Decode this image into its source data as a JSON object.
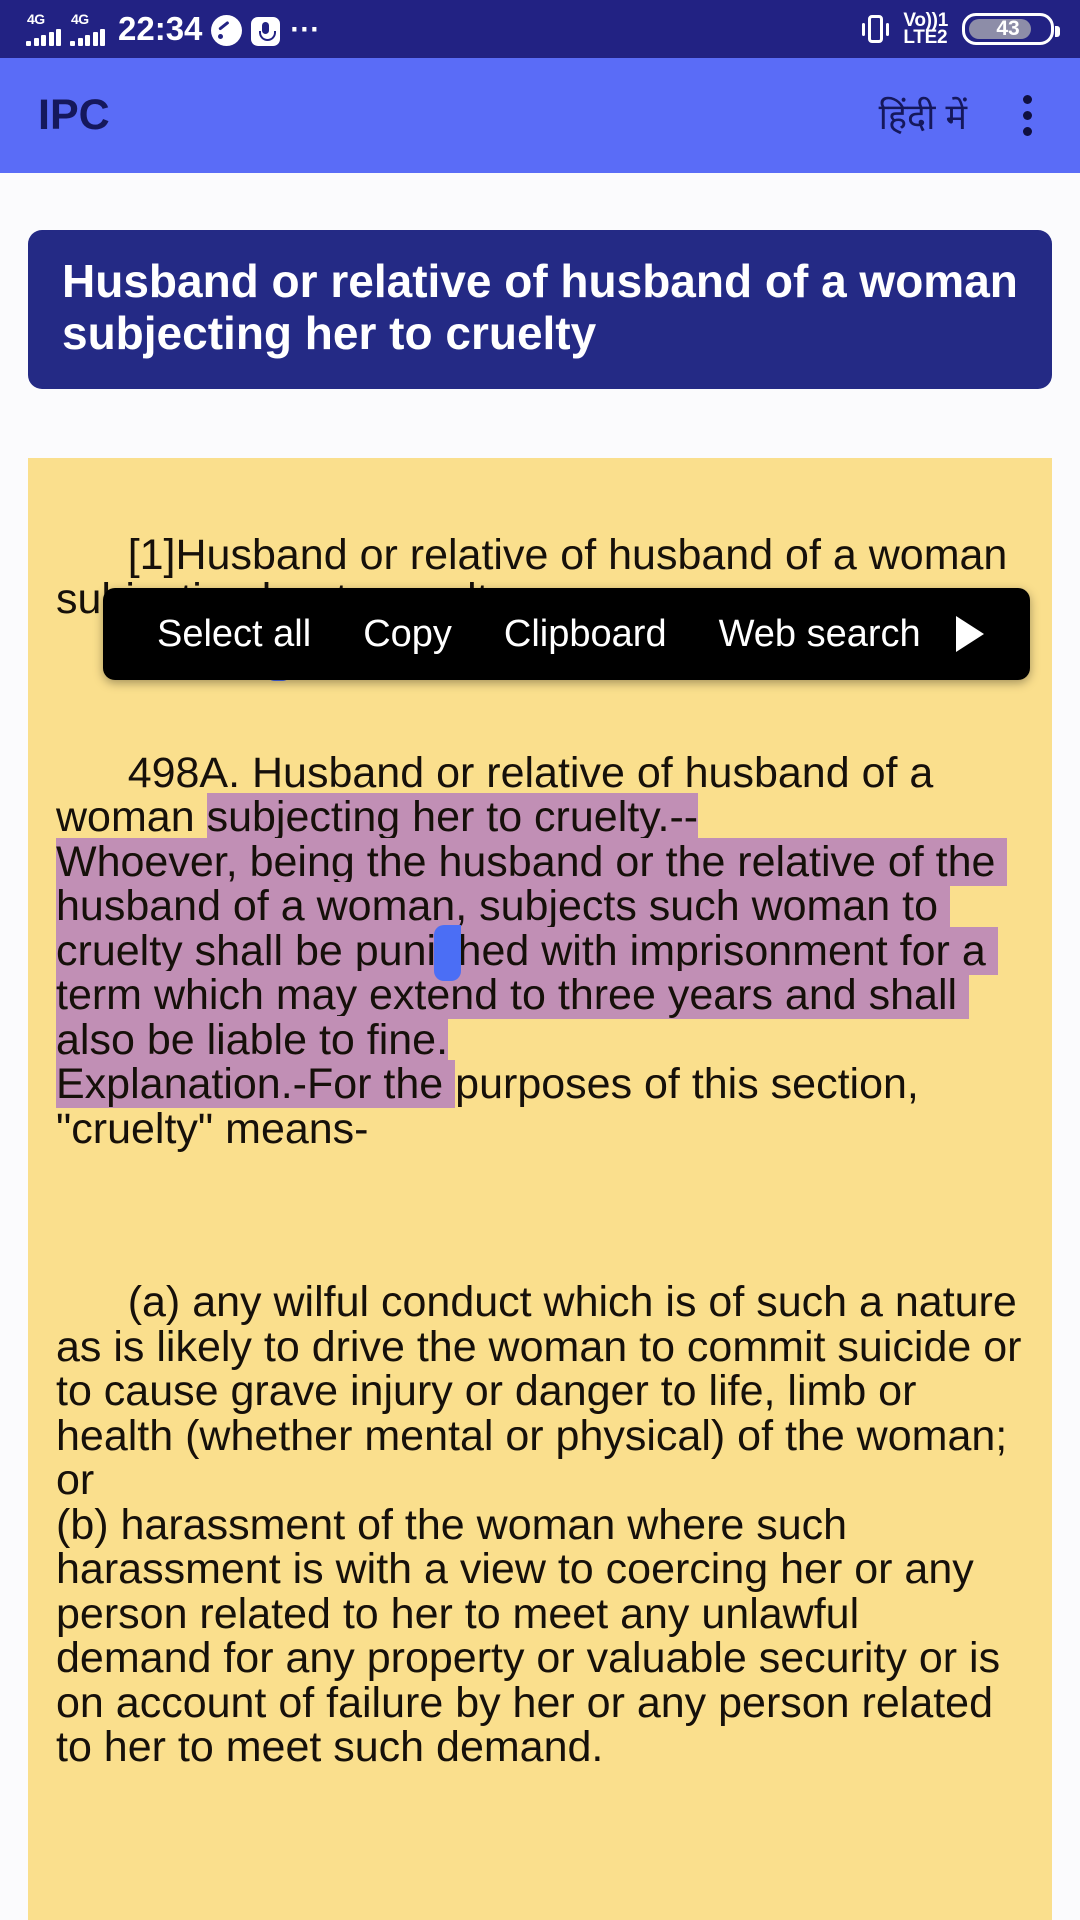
{
  "status_bar": {
    "network_1": "4G",
    "network_2": "4G",
    "time": "22:34",
    "speed_icon": "speedometer-icon",
    "mic_icon": "microphone-icon",
    "overflow_icon": "more-dots-icon",
    "vibrate_icon": "vibrate-icon",
    "volte_line1": "Vo))",
    "volte_sim": "1",
    "volte_line2": "LTE2",
    "battery_level": "43"
  },
  "app_bar": {
    "title": "IPC",
    "language_toggle": "हिंदी में",
    "overflow_menu_icon": "kebab-menu-icon"
  },
  "section": {
    "heading": "Husband or relative of husband of a woman subjecting her to cruelty",
    "paragraph_1": "[1]Husband or relative of husband of a woman subjecting her to cruelty.",
    "paragraph_2_prefix": "498A. Husband or relative of husband of a woman ",
    "paragraph_2_selected": "subjecting her to cruelty.--\nWhoever, being the husband or the relative of the husband of a woman, subjects such woman to cruelty shall be punished with imprisonment for a term which may extend to three years and shall also be liable to fine.\nExplanation.-For the ",
    "paragraph_2_suffix": "purposes of this section, \"cruelty\" means-",
    "paragraph_3": "(a) any wilful conduct which is of such a nature as is likely to drive the woman to commit suicide or to cause grave injury or danger to life, limb or health (whether mental or physical) of the woman; or\n(b) harassment of the woman where such harassment is with a view to coercing her or any person related to her to meet any unlawful demand for any property or valuable security or is on account of failure by her or any person related to her to meet such demand."
  },
  "context_menu": {
    "items": [
      {
        "label": "Select all"
      },
      {
        "label": "Copy"
      },
      {
        "label": "Clipboard"
      },
      {
        "label": "Web search"
      }
    ],
    "more_icon": "play-triangle-icon"
  },
  "colors": {
    "status_bar_bg": "#222283",
    "app_bar_bg": "#5a6cf7",
    "app_bar_text": "#15185c",
    "title_card_bg": "#242a85",
    "content_card_bg": "#fadf8d",
    "selection_highlight": "#c18fb5",
    "selection_handle": "#4b6ef5",
    "context_menu_bg": "#000000",
    "page_bg": "#fbfbfd"
  }
}
